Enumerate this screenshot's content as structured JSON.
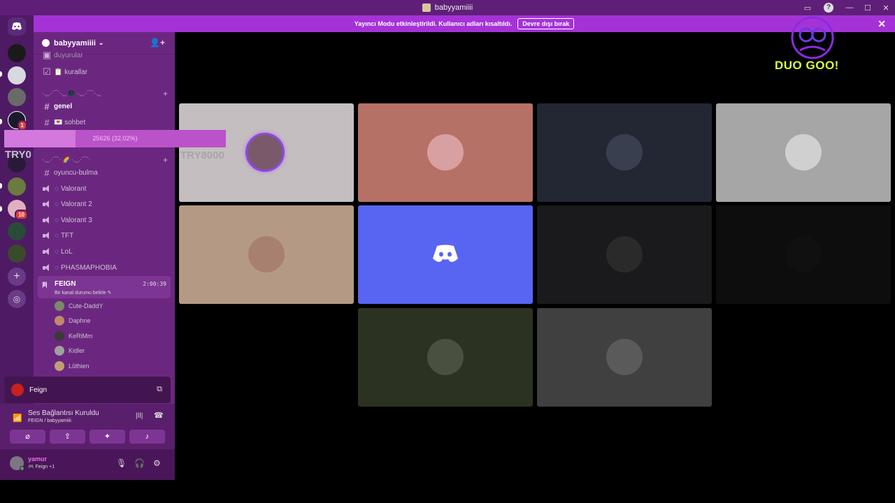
{
  "window": {
    "title": "babyyamiiii",
    "controls": [
      "—",
      "☐",
      "✕"
    ]
  },
  "notice": {
    "text": "Yayıncı Modu etkinleştirildi. Kullanıcı adları kısaltıldı.",
    "button": "Devre dışı bırak",
    "close": "✕"
  },
  "server": {
    "name": "babyyamiiii"
  },
  "channels": {
    "top_cut": "duyurular",
    "rules": "📋 kurallar",
    "category1": "·.¸¸.·´¯`·.¸¸ 🌑 ·.¸¸.·´¯`·.¸¸",
    "genel": "genel",
    "sohbet": "💌 sohbet",
    "category2": "·.¸¸.·´¯`· 🌈 ·.¸¸.·´¯`·",
    "oyuncu": "oyuncu-bulma",
    "voice": [
      "Valorant",
      "Valorant 2",
      "Valorant 3",
      "TFT",
      "LoL",
      "PHASMAPHOBIA"
    ],
    "active_voice": {
      "name": "FEIGN",
      "time": "2:00:39",
      "status": "Bir kanal durumu belirle"
    },
    "members": [
      "Cute-DaddY",
      "Daphne",
      "KeRiMm",
      "Kidler",
      "Lûthien"
    ]
  },
  "progress": {
    "text": "25626 (32.02%)",
    "fraction": 0.3202
  },
  "overlay_label": "TRY0",
  "stream_panel": {
    "name": "Feign"
  },
  "voice_conn": {
    "title": "Ses Bağlantısı Kuruldu",
    "sub": "FEIGN / babyyamiiii"
  },
  "user": {
    "name": "yamur",
    "status": "🎮 Feign +1"
  },
  "tiles": [
    {
      "bg": "#c4bec0",
      "ava": "#7a5a6a",
      "label": "TRY8000"
    },
    {
      "bg": "#b67166",
      "ava": "#d8a0a0"
    },
    {
      "bg": "#232733",
      "ava": "#3a3f50"
    },
    {
      "bg": "#a6a6a6",
      "ava": "#d0d0d0"
    },
    {
      "bg": "#b49a84",
      "ava": "#a88070"
    },
    {
      "bg": "#5865f2"
    },
    {
      "bg": "#1a1a1d",
      "ava": "#2a2a2a"
    },
    {
      "bg": "#0d0d0d",
      "ava": "#101010"
    },
    {
      "bg": "#2c3221",
      "ava": "#4a5040"
    },
    {
      "bg": "#404040",
      "ava": "#5a5a5a"
    }
  ],
  "logo": {
    "text": "DUO GOO!"
  },
  "colors": {
    "accent": "#a532d6",
    "sidebar": "#6b2780",
    "rail": "#4e1a64"
  }
}
